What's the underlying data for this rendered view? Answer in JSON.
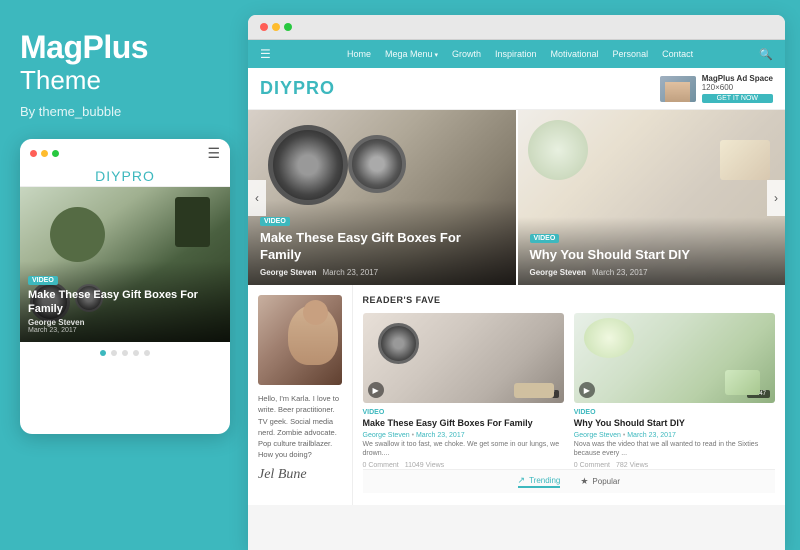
{
  "brand": {
    "name": "MagPlus",
    "subtitle": "Theme",
    "by": "By theme_bubble"
  },
  "mobile": {
    "logo": "DIYPRO",
    "hero_badge": "VIDEO",
    "hero_title": "Make These Easy Gift Boxes For Family",
    "hero_author": "George Steven",
    "hero_date": "March 23, 2017"
  },
  "browser": {
    "nav": {
      "home": "Home",
      "mega_menu": "Mega Menu",
      "growth": "Growth",
      "inspiration": "Inspiration",
      "motivational": "Motivational",
      "personal": "Personal",
      "contact": "Contact"
    },
    "logo": "DIYPRO",
    "ad": {
      "label": "MagPlus Ad Space",
      "size": "120×600",
      "btn": "GET IT NOW"
    },
    "slide1": {
      "badge": "VIDEO",
      "title": "Make These Easy Gift Boxes For Family",
      "author": "George Steven",
      "date": "March 23, 2017"
    },
    "slide2": {
      "badge": "VIDEO",
      "title": "Why You Should Start DIY",
      "author": "George Steven",
      "date": "March 23, 2017"
    },
    "author_bio": "Hello, I'm Karla. I love to write. Beer practitioner. TV geek. Social media nerd. Zombie advocate. Pop culture trailblazer. How you doing?",
    "signature": "Jel Bune",
    "readers_fave": "Reader's Fave",
    "card1": {
      "video_label": "VIDEO",
      "title": "Make These Easy Gift Boxes For Family",
      "author": "George Steven",
      "date": "March 23, 2017",
      "excerpt": "We swallow it too fast, we choke. We get some in our lungs, we drown....",
      "comments": "0 Comment",
      "views": "11049 Views"
    },
    "card2": {
      "video_label": "VIDEO",
      "title": "Why You Should Start DIY",
      "author": "George Steven",
      "date": "March 23, 2017",
      "excerpt": "Nova was the video that we all wanted to read in the Sixties because every ...",
      "comments": "0 Comment",
      "views": "782 Views",
      "time1": "56:47",
      "time2": "16:47"
    },
    "tabs": {
      "trending": "Trending",
      "popular": "Popular"
    }
  }
}
